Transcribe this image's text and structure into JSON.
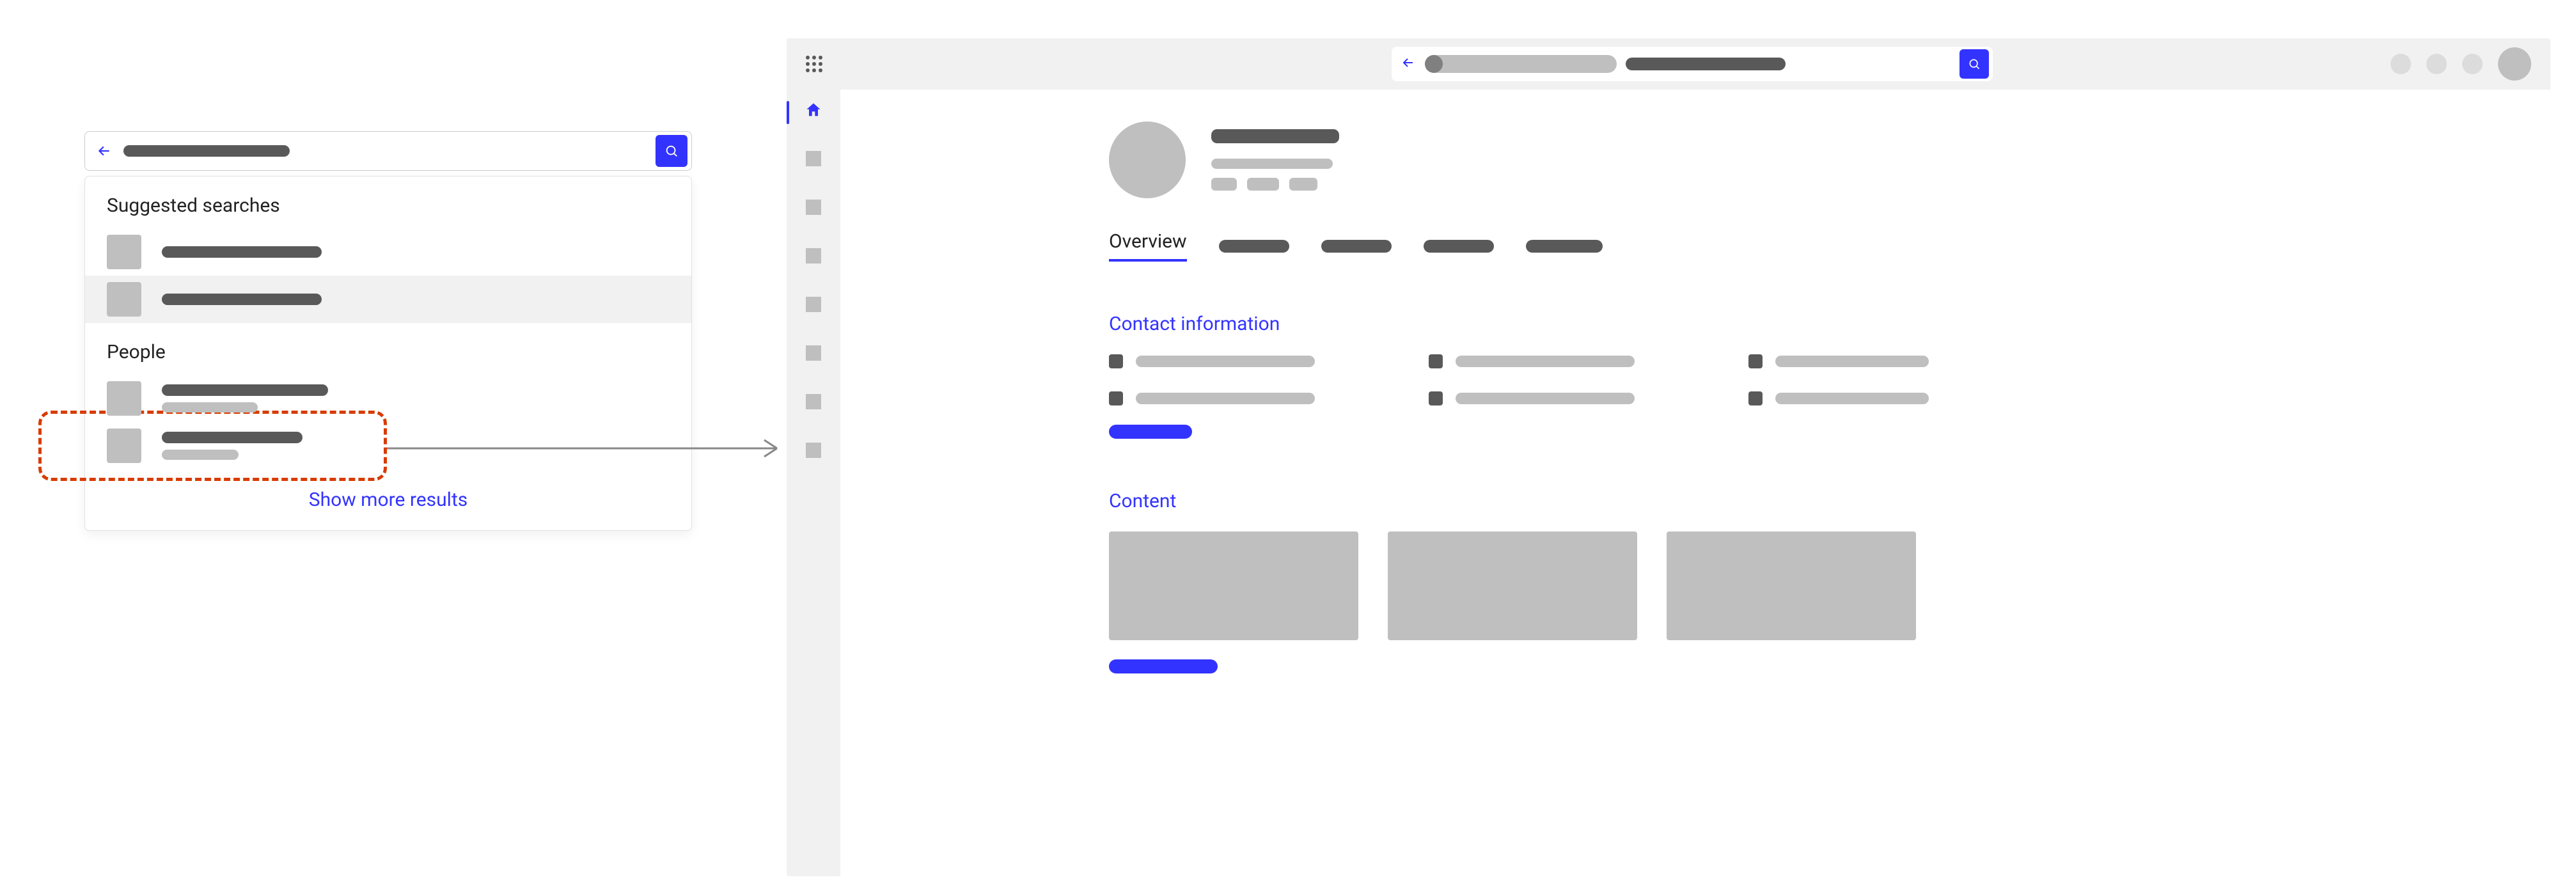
{
  "dropdown": {
    "section_suggested": "Suggested searches",
    "section_people": "People",
    "show_more": "Show more results"
  },
  "profile": {
    "tabs": {
      "overview": "Overview"
    },
    "sections": {
      "contact": "Contact information",
      "content": "Content"
    }
  }
}
